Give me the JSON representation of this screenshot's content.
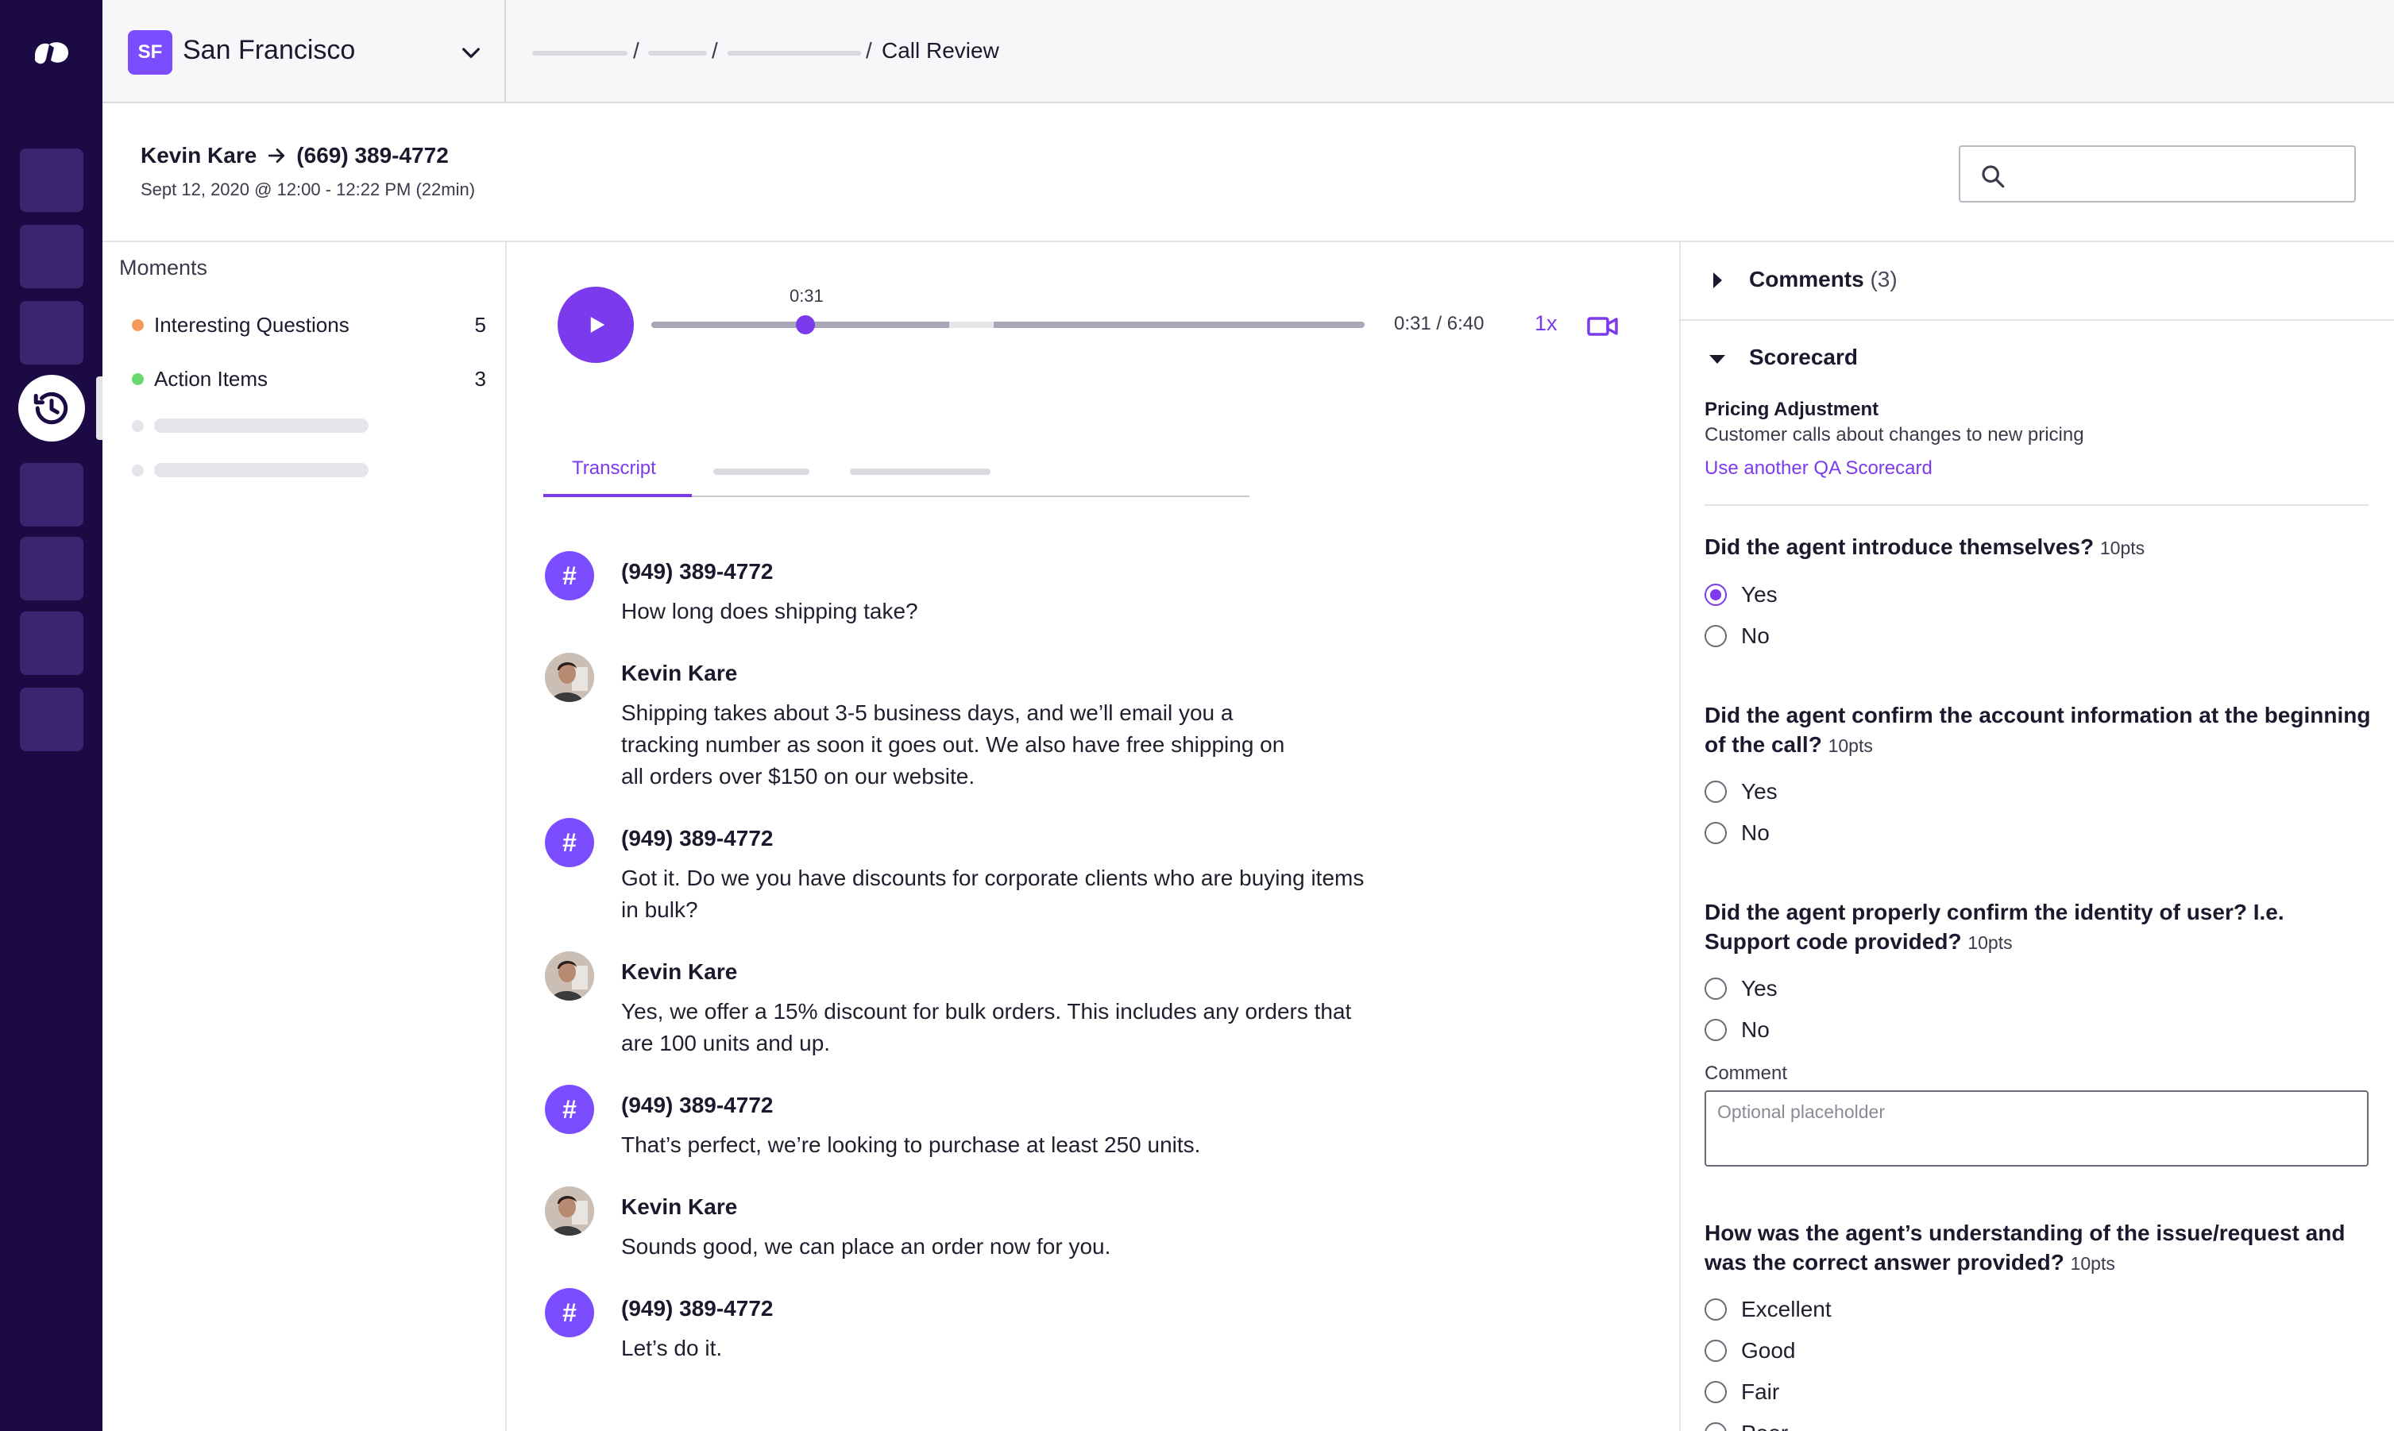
{
  "location": {
    "badge": "SF",
    "name": "San Francisco"
  },
  "breadcrumb": {
    "separator": "/",
    "current": "Call Review"
  },
  "call": {
    "caller": "Kevin Kare",
    "arrow": "→",
    "number": "(669) 389-4772",
    "meta": "Sept 12, 2020  @ 12:00 - 12:22 PM  (22min)"
  },
  "search": {
    "placeholder": ""
  },
  "moments": {
    "title": "Moments",
    "items": [
      {
        "label": "Interesting Questions",
        "count": "5",
        "color": "#f59a5a"
      },
      {
        "label": "Action Items",
        "count": "3",
        "color": "#67d86b"
      }
    ]
  },
  "player": {
    "current_label": "0:31",
    "time": "0:31 / 6:40",
    "speed": "1x",
    "progress": 0.216,
    "buffered_gap": [
      0.418,
      0.48
    ]
  },
  "tabs": {
    "active": "Transcript"
  },
  "transcript": [
    {
      "type": "caller",
      "avatar": "#",
      "speaker": "(949) 389-4772",
      "text": "How long does shipping take?"
    },
    {
      "type": "agent",
      "speaker": "Kevin Kare",
      "text": "Shipping takes about 3-5 business days, and we’ll email you a tracking number as soon it goes out. We also have free shipping on all orders over $150 on our website."
    },
    {
      "type": "caller",
      "avatar": "#",
      "speaker": "(949) 389-4772",
      "text": "Got it. Do we you have discounts for corporate clients who are buying items in bulk?"
    },
    {
      "type": "agent",
      "speaker": "Kevin Kare",
      "text": "Yes, we offer a 15% discount for bulk orders. This includes any orders that are 100 units and up."
    },
    {
      "type": "caller",
      "avatar": "#",
      "speaker": "(949) 389-4772",
      "text": "That’s perfect, we’re looking to purchase at least 250 units."
    },
    {
      "type": "agent",
      "speaker": "Kevin Kare",
      "text": "Sounds good, we can place an order now for you."
    },
    {
      "type": "caller",
      "avatar": "#",
      "speaker": "(949) 389-4772",
      "text": "Let’s do it."
    }
  ],
  "comments": {
    "title": "Comments",
    "count": "(3)"
  },
  "scorecard": {
    "title": "Scorecard",
    "name": "Pricing Adjustment",
    "description": "Customer calls about changes to new pricing",
    "link": "Use another QA Scorecard",
    "questions": [
      {
        "text": "Did the agent introduce themselves?",
        "pts": "10pts",
        "options": [
          "Yes",
          "No"
        ],
        "selected": "Yes"
      },
      {
        "text": "Did the agent confirm the account information at the beginning of the call?",
        "pts": "10pts",
        "options": [
          "Yes",
          "No"
        ],
        "selected": null
      },
      {
        "text": "Did the agent properly confirm the identity of user? I.e. Support code provided?",
        "pts": "10pts",
        "options": [
          "Yes",
          "No"
        ],
        "selected": null
      },
      {
        "text": "How was the agent’s understanding of the issue/request and was the correct answer provided?",
        "pts": "10pts",
        "options": [
          "Excellent",
          "Good",
          "Fair",
          "Poor"
        ],
        "selected": null
      }
    ],
    "comment_label": "Comment",
    "comment_placeholder": "Optional placeholder"
  },
  "colors": {
    "rail": "#1c0a45",
    "accent": "#7c3aed",
    "badge": "#7c4dff"
  },
  "icons": [
    "logo-icon",
    "history-icon",
    "chevron-down-icon",
    "arrow-right-icon",
    "search-icon",
    "play-icon",
    "video-icon",
    "caret-right-icon",
    "caret-down-icon"
  ]
}
